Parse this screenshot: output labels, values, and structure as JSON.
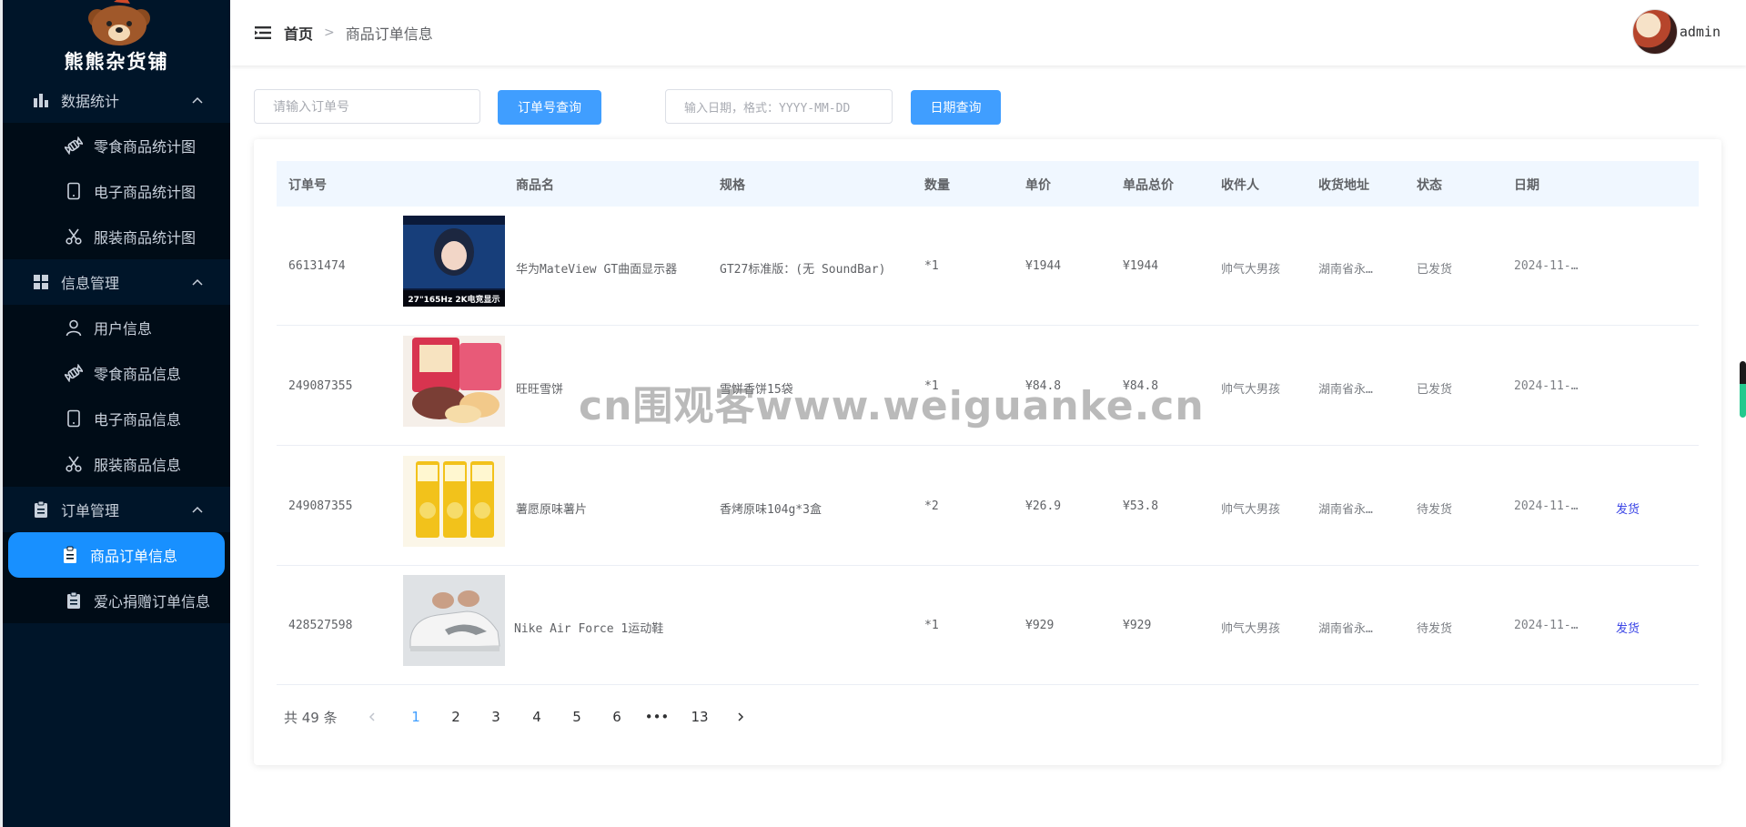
{
  "app": {
    "logo_text": "熊熊杂货铺",
    "username": "admin"
  },
  "colors": {
    "sidebar_bg": "#001529",
    "accent": "#1890ff",
    "button": "#409eff",
    "action_link": "#3b45e6"
  },
  "sidebar": {
    "groups": [
      {
        "label": "数据统计",
        "icon": "bar-chart-icon",
        "items": [
          {
            "label": "零食商品统计图",
            "icon": "candy-icon"
          },
          {
            "label": "电子商品统计图",
            "icon": "tablet-icon"
          },
          {
            "label": "服装商品统计图",
            "icon": "scissors-icon"
          }
        ]
      },
      {
        "label": "信息管理",
        "icon": "grid-icon",
        "items": [
          {
            "label": "用户信息",
            "icon": "user-icon"
          },
          {
            "label": "零食商品信息",
            "icon": "candy-icon"
          },
          {
            "label": "电子商品信息",
            "icon": "tablet-icon"
          },
          {
            "label": "服装商品信息",
            "icon": "scissors-icon"
          }
        ]
      },
      {
        "label": "订单管理",
        "icon": "clipboard-icon",
        "items": [
          {
            "label": "商品订单信息",
            "icon": "clipboard-icon",
            "active": true
          },
          {
            "label": "爱心捐赠订单信息",
            "icon": "clipboard-icon"
          }
        ]
      }
    ]
  },
  "breadcrumb": {
    "home": "首页",
    "separator": ">",
    "current": "商品订单信息"
  },
  "search": {
    "order_placeholder": "请输入订单号",
    "order_button": "订单号查询",
    "date_placeholder": "输入日期，格式：YYYY-MM-DD",
    "date_button": "日期查询"
  },
  "table": {
    "columns": [
      "订单号",
      "商品名",
      "规格",
      "数量",
      "单价",
      "单品总价",
      "收件人",
      "收货地址",
      "状态",
      "日期"
    ],
    "rows": [
      {
        "order_no": "66131474",
        "name": "华为MateView GT曲面显示器",
        "spec": "GT27标准版：(无 SoundBar)",
        "qty": "*1",
        "price": "¥1944",
        "total": "¥1944",
        "receiver": "帅气大男孩",
        "address": "湖南省永…",
        "status": "已发货",
        "date": "2024-11-…",
        "action": "",
        "thumb": "monitor",
        "thumb_caption": "27\"165Hz 2K电竞显示"
      },
      {
        "order_no": "249087355",
        "name": "旺旺雪饼",
        "spec": "雪饼香饼15袋",
        "qty": "*1",
        "price": "¥84.8",
        "total": "¥84.8",
        "receiver": "帅气大男孩",
        "address": "湖南省永…",
        "status": "已发货",
        "date": "2024-11-…",
        "action": "",
        "thumb": "snack",
        "thumb_caption": ""
      },
      {
        "order_no": "249087355",
        "name": "薯愿原味薯片",
        "spec": "香烤原味104g*3盒",
        "qty": "*2",
        "price": "¥26.9",
        "total": "¥53.8",
        "receiver": "帅气大男孩",
        "address": "湖南省永…",
        "status": "待发货",
        "date": "2024-11-…",
        "action": "发货",
        "thumb": "chips",
        "thumb_caption": ""
      },
      {
        "order_no": "428527598",
        "name": "Nike Air Force 1运动鞋",
        "spec": "",
        "qty": "*1",
        "price": "¥929",
        "total": "¥929",
        "receiver": "帅气大男孩",
        "address": "湖南省永…",
        "status": "待发货",
        "date": "2024-11-…",
        "action": "发货",
        "thumb": "shoe",
        "thumb_caption": ""
      }
    ]
  },
  "pagination": {
    "total_text": "共 49 条",
    "pages": [
      "1",
      "2",
      "3",
      "4",
      "5",
      "6",
      "•••",
      "13"
    ],
    "current": "1"
  },
  "watermark": "cn围观客www.weiguanke.cn"
}
